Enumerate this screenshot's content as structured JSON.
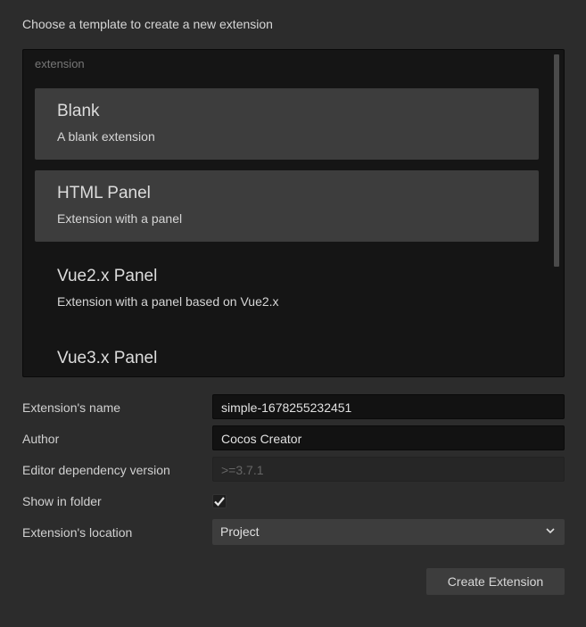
{
  "heading": "Choose a template to create a new extension",
  "template_list": {
    "group": "extension",
    "items": [
      {
        "title": "Blank",
        "description": "A blank extension",
        "highlighted": true
      },
      {
        "title": "HTML Panel",
        "description": "Extension with a panel",
        "highlighted": true
      },
      {
        "title": "Vue2.x Panel",
        "description": "Extension with a panel based on Vue2.x",
        "highlighted": false
      },
      {
        "title": "Vue3.x Panel",
        "description": "",
        "highlighted": false
      }
    ]
  },
  "form": {
    "name_label": "Extension's name",
    "name_value": "simple-1678255232451",
    "author_label": "Author",
    "author_value": "Cocos Creator",
    "editor_label": "Editor dependency version",
    "editor_placeholder": ">=3.7.1",
    "folder_label": "Show in folder",
    "folder_checked": true,
    "location_label": "Extension's location",
    "location_value": "Project"
  },
  "create_button": "Create Extension"
}
